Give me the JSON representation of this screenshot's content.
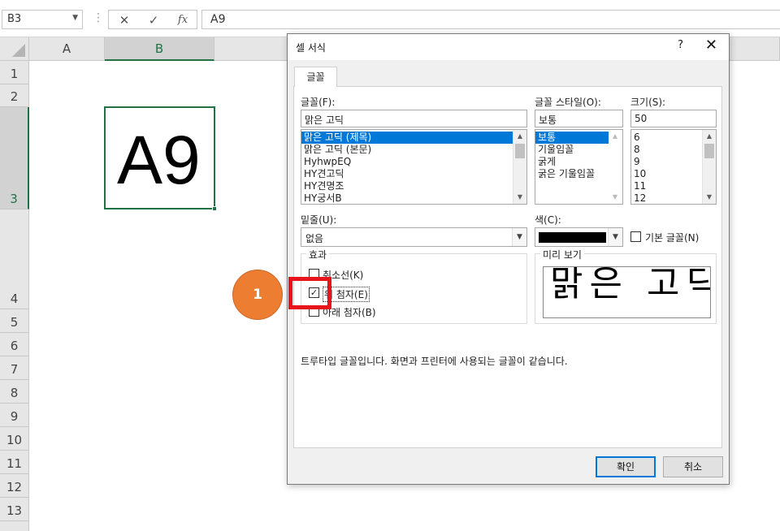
{
  "formula_bar": {
    "name_box": "B3",
    "formula": "A9",
    "icons": [
      "cancel-icon",
      "enter-icon",
      "function-icon"
    ],
    "fx_label": "fx"
  },
  "grid": {
    "columns": [
      "A",
      "B"
    ],
    "selected_column": "B",
    "rows": [
      "1",
      "2",
      "3",
      "4",
      "5",
      "6",
      "7",
      "8",
      "9",
      "10",
      "11",
      "12",
      "13"
    ],
    "selected_row": "3",
    "active_cell_text": "A9",
    "active_cell_color": "#217346"
  },
  "step_marker": {
    "label": "1",
    "color": "#ed7d31"
  },
  "dialog": {
    "title": "셀 서식",
    "help": "?",
    "close": "✕",
    "tab": "글꼴",
    "font": {
      "label": "글꼴(F):",
      "value": "맑은 고딕",
      "items": [
        "맑은 고딕 (제목)",
        "맑은 고딕 (본문)",
        "HyhwpEQ",
        "HY견고딕",
        "HY견명조",
        "HY궁서B"
      ],
      "selected_index": 0
    },
    "style": {
      "label": "글꼴 스타일(O):",
      "value": "보통",
      "items": [
        "보통",
        "기울임꼴",
        "굵게",
        "굵은 기울임꼴"
      ],
      "selected_index": 0
    },
    "size": {
      "label": "크기(S):",
      "value": "50",
      "items": [
        "6",
        "8",
        "9",
        "10",
        "11",
        "12"
      ]
    },
    "underline": {
      "label": "밑줄(U):",
      "value": "없음"
    },
    "color": {
      "label": "색(C):",
      "value_color": "#000000"
    },
    "normal_font": {
      "label": "기본 글꼴(N)",
      "checked": false
    },
    "effects": {
      "title": "효과",
      "strikethrough": {
        "label": "취소선(K)",
        "checked": false
      },
      "superscript": {
        "label": "위 첨자(E)",
        "checked": true
      },
      "subscript": {
        "label": "아래 첨자(B)",
        "checked": false
      }
    },
    "preview": {
      "title": "미리 보기",
      "text": "맑은 고딕"
    },
    "note": "트루타입 글꼴입니다. 화면과 프린터에 사용되는 글꼴이 같습니다.",
    "ok": "확인",
    "cancel": "취소"
  },
  "highlight_color": "#e8141b"
}
